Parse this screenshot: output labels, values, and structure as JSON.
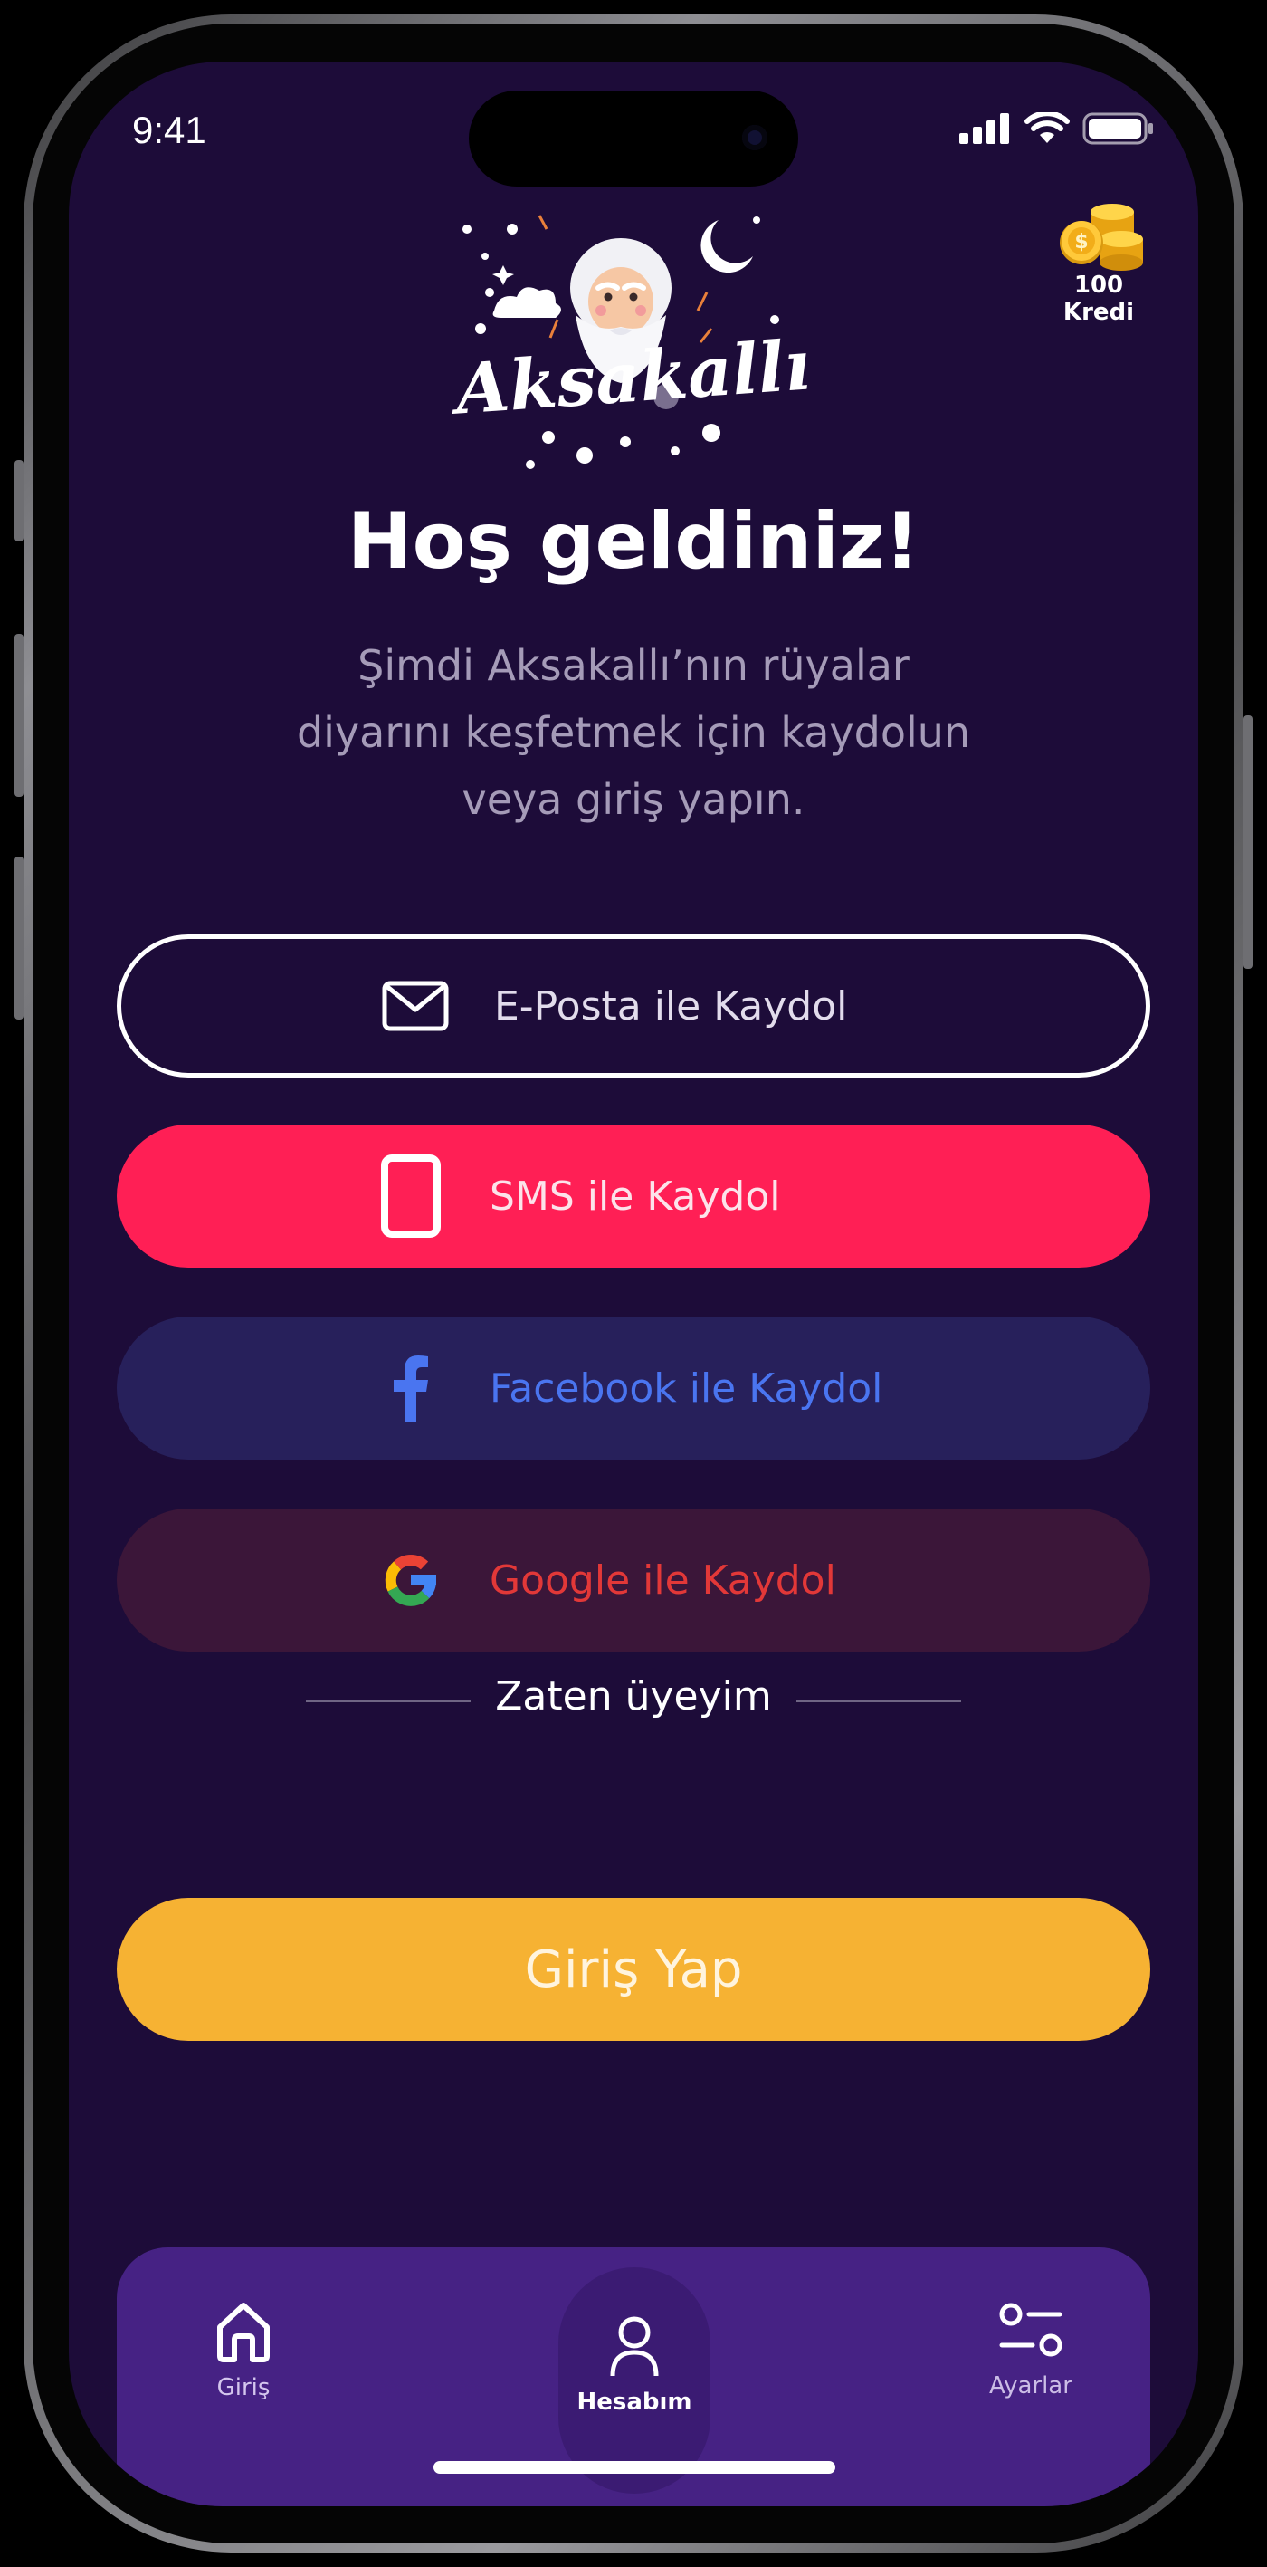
{
  "status_bar": {
    "time": "9:41"
  },
  "credit": {
    "label": "100 Kredi"
  },
  "logo": {
    "text": "Aksakallı"
  },
  "welcome": {
    "title": "Hoş geldiniz!",
    "subtitle_line1": "Şimdi Aksakallı’nın rüyalar",
    "subtitle_line2": "diyarını keşfetmek için kaydolun",
    "subtitle_line3": "veya giriş yapın."
  },
  "signup": {
    "email_label": "E-Posta ile Kaydol",
    "sms_label": "SMS ile Kaydol",
    "facebook_label": "Facebook ile Kaydol",
    "google_label": "Google ile Kaydol"
  },
  "divider": {
    "text": "Zaten üyeyim"
  },
  "login": {
    "label": "Giriş Yap"
  },
  "tabbar": {
    "items": [
      {
        "label": "Giriş",
        "icon": "home-icon",
        "active": false
      },
      {
        "label": "Hesabım",
        "icon": "user-icon",
        "active": true
      },
      {
        "label": "Ayarlar",
        "icon": "sliders-icon",
        "active": false
      }
    ]
  },
  "colors": {
    "background": "#1d0c39",
    "sms": "#ff1f55",
    "facebook_bg": "#27205b",
    "facebook_text": "#4a75f0",
    "google_bg": "#3b1639",
    "google_text": "#e23838",
    "login": "#f6b233",
    "tabbar": "#462284"
  }
}
